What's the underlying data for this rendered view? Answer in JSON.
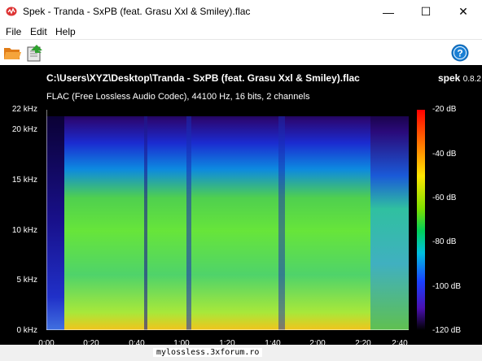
{
  "window": {
    "title": "Spek - Tranda - SxPB (feat. Grasu Xxl & Smiley).flac",
    "minimize_glyph": "—",
    "maximize_glyph": "☐",
    "close_glyph": "✕"
  },
  "menu": {
    "items": [
      "File",
      "Edit",
      "Help"
    ]
  },
  "toolbar": {
    "icons": [
      "open-folder-icon",
      "save-icon",
      "help-icon"
    ]
  },
  "spectrogram": {
    "file_path": "C:\\Users\\XYZ\\Desktop\\Tranda - SxPB (feat. Grasu Xxl & Smiley).flac",
    "app_name": "spek",
    "app_version": "0.8.2",
    "codec_info": "FLAC (Free Lossless Audio Codec), 44100 Hz, 16 bits, 2 channels",
    "y_labels": [
      "22 kHz",
      "20 kHz",
      "15 kHz",
      "10 kHz",
      "5 kHz",
      "0 kHz"
    ],
    "y_values_khz": [
      22,
      20,
      15,
      10,
      5,
      0
    ],
    "x_labels": [
      "0:00",
      "0:20",
      "0:40",
      "1:00",
      "1:20",
      "1:40",
      "2:00",
      "2:20",
      "2:40"
    ],
    "x_values_s": [
      0,
      20,
      40,
      60,
      80,
      100,
      120,
      140,
      160
    ],
    "db_labels": [
      "-20 dB",
      "-40 dB",
      "-60 dB",
      "-80 dB",
      "-100 dB",
      "-120 dB"
    ],
    "db_values": [
      -20,
      -40,
      -60,
      -80,
      -100,
      -120
    ]
  },
  "status": {
    "text": "mylossless.3xforum.ro"
  },
  "colors": {
    "background": "#000000",
    "accent": "#1a7fd4"
  }
}
